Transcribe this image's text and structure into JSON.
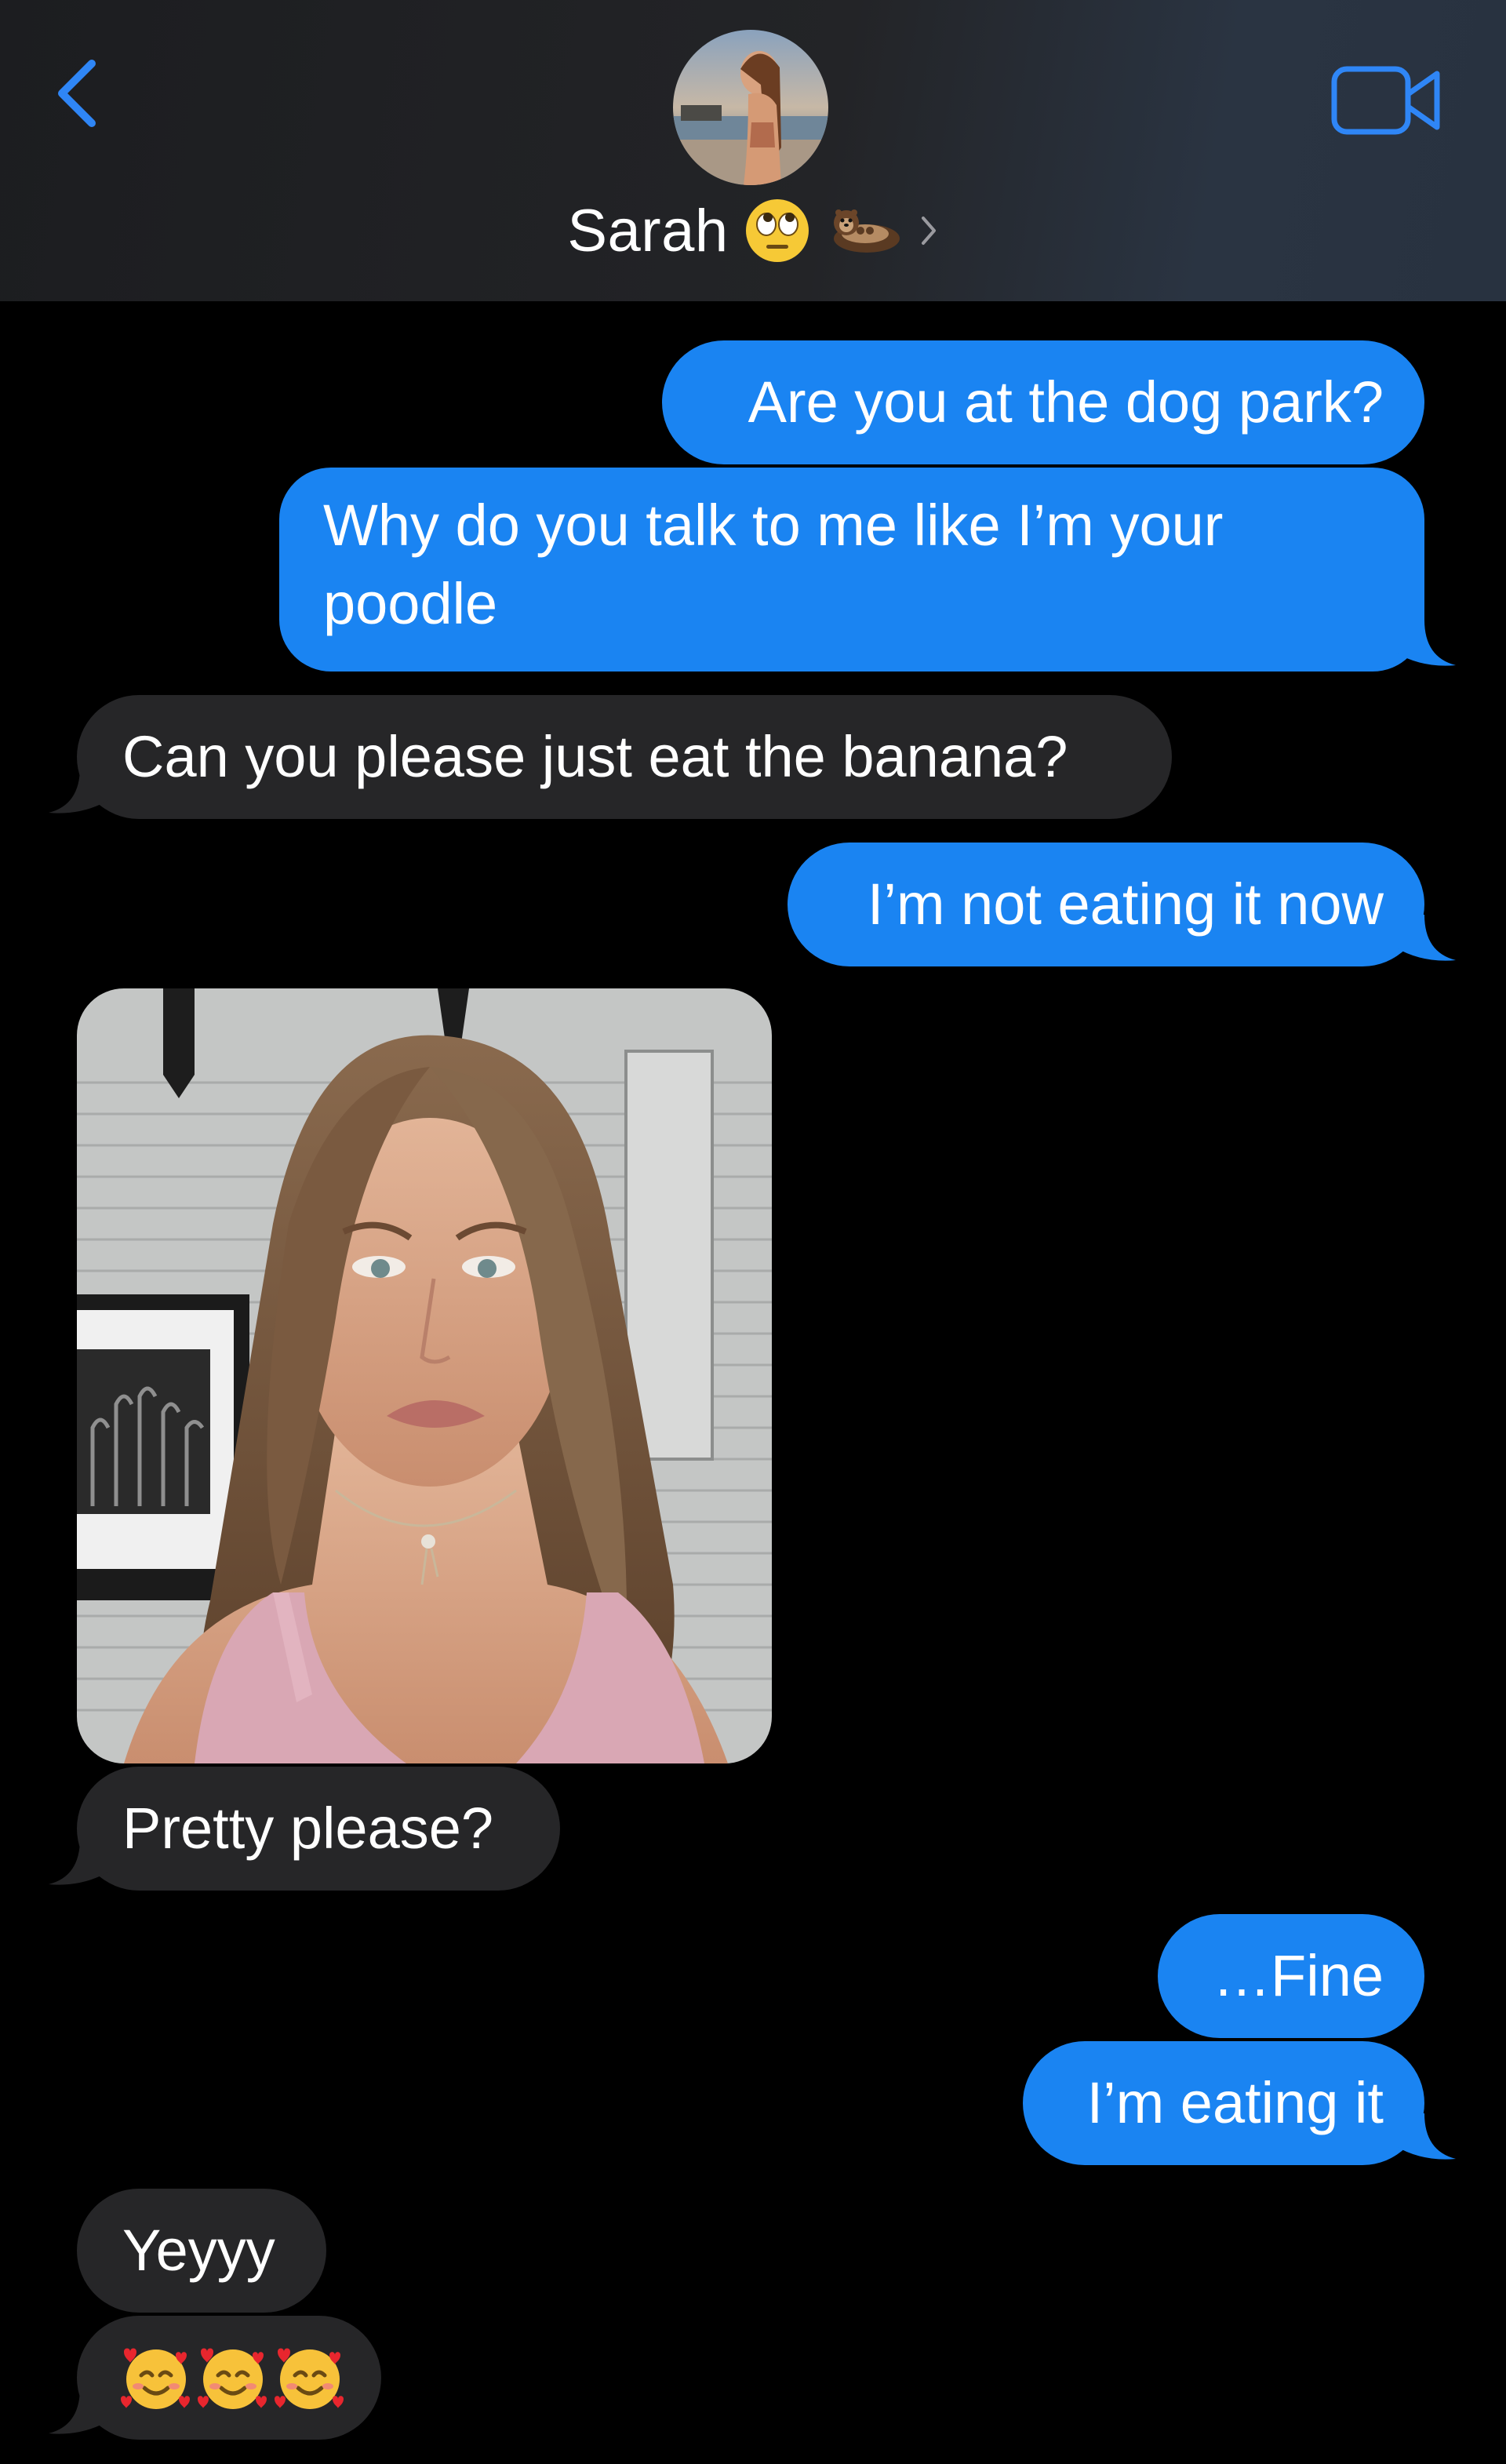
{
  "header": {
    "contact_name": "Sarah",
    "name_emoji_icons": [
      "face-with-rolling-eyes-icon",
      "otter-icon"
    ],
    "back_icon": "chevron-left-icon",
    "video_icon": "video-camera-icon"
  },
  "colors": {
    "outgoing_bubble": "#1a84f2",
    "incoming_bubble": "#262628",
    "accent": "#2f86f6",
    "background": "#000000"
  },
  "messages": [
    {
      "direction": "outgoing",
      "text": "Are you at the dog park?"
    },
    {
      "direction": "outgoing",
      "lines": [
        "Why do you talk to me like I’m your",
        "poodle"
      ]
    },
    {
      "direction": "incoming",
      "text": "Can you please just eat the banana?"
    },
    {
      "direction": "outgoing",
      "text": "I’m not eating it now"
    },
    {
      "direction": "incoming",
      "type": "photo"
    },
    {
      "direction": "incoming",
      "text": "Pretty please?"
    },
    {
      "direction": "outgoing",
      "text": "…Fine"
    },
    {
      "direction": "outgoing",
      "text": "I’m eating it"
    },
    {
      "direction": "incoming",
      "text": "Yeyyy"
    },
    {
      "direction": "incoming",
      "type": "emoji",
      "emoji_icons": [
        "smiling-face-with-hearts-icon",
        "smiling-face-with-hearts-icon",
        "smiling-face-with-hearts-icon"
      ]
    }
  ]
}
